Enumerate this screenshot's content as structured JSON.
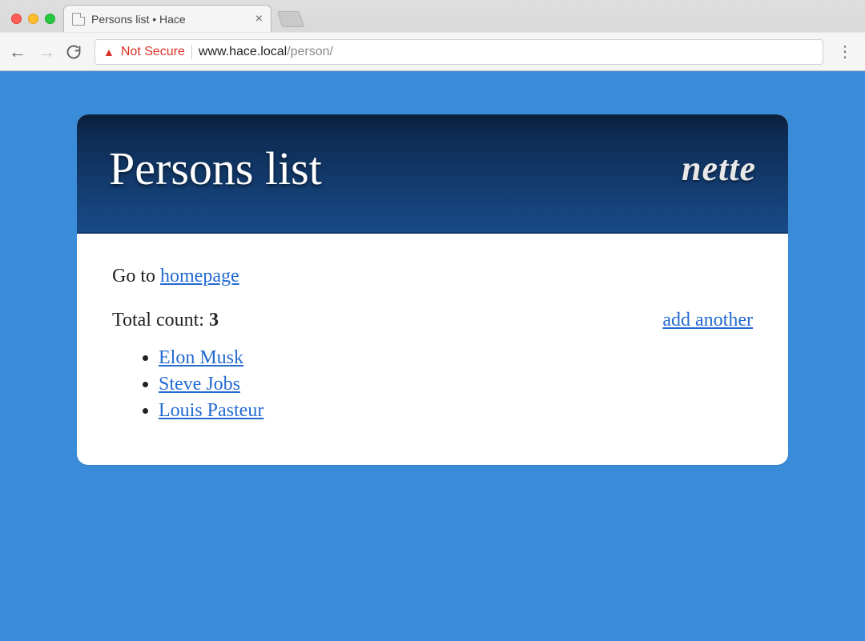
{
  "browser": {
    "tab_title": "Persons list • Hace",
    "not_secure_label": "Not Secure",
    "url_host": "www.hace.local",
    "url_path": "/person/"
  },
  "header": {
    "title": "Persons list",
    "logo_text": "nette"
  },
  "body": {
    "goto_prefix": "Go to ",
    "goto_link": "homepage",
    "total_label": "Total count: ",
    "total_value": "3",
    "add_link": "add another",
    "persons": [
      "Elon Musk",
      "Steve Jobs",
      "Louis Pasteur"
    ]
  }
}
